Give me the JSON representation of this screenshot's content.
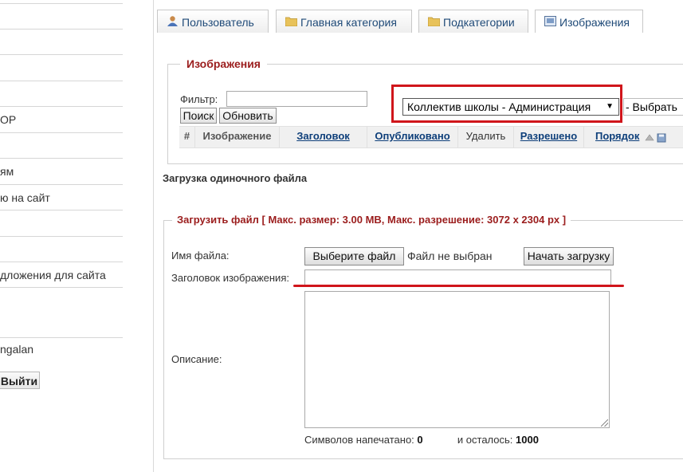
{
  "sidebar": {
    "item_op": "OP",
    "item_yam": "ям",
    "item_site": "ю на сайт",
    "item_apps": "дложения для сайта",
    "user": "ngalan",
    "logout": "Выйти"
  },
  "tabs": [
    {
      "label": "Пользователь",
      "icon": "user-icon"
    },
    {
      "label": "Главная категория",
      "icon": "folder-icon"
    },
    {
      "label": "Подкатегории",
      "icon": "folder-icon"
    },
    {
      "label": "Изображения",
      "icon": "image-icon"
    }
  ],
  "images": {
    "legend": "Изображения",
    "filter_label": "Фильтр:",
    "filter_value": "",
    "search_btn": "Поиск",
    "refresh_btn": "Обновить",
    "category_selected": "Коллектив школы - Администрация",
    "select_tail": "- Выбрать",
    "columns": [
      "#",
      "Изображение",
      "Заголовок",
      "Опубликовано",
      "Удалить",
      "Разрешено",
      "Порядок"
    ]
  },
  "upload": {
    "section_title": "Загрузка одиночного файла",
    "legend": "Загрузить файл [ Макс. размер: 3.00 MB, Макс. разрешение: 3072 x 2304 px ]",
    "filename_label": "Имя файла:",
    "choose_btn": "Выберите файл",
    "file_status": "Файл не выбран",
    "start_btn": "Начать загрузку",
    "title_label": "Заголовок изображения:",
    "title_value": "",
    "desc_label": "Описание:",
    "typed_label": "Символов напечатано:",
    "typed_count": "0",
    "left_label": "и осталось:",
    "left_count": "1000"
  },
  "colors": {
    "legend_red": "#9b1d1d",
    "highlight_red": "#d0151b",
    "link_blue": "#0e3f7a"
  }
}
